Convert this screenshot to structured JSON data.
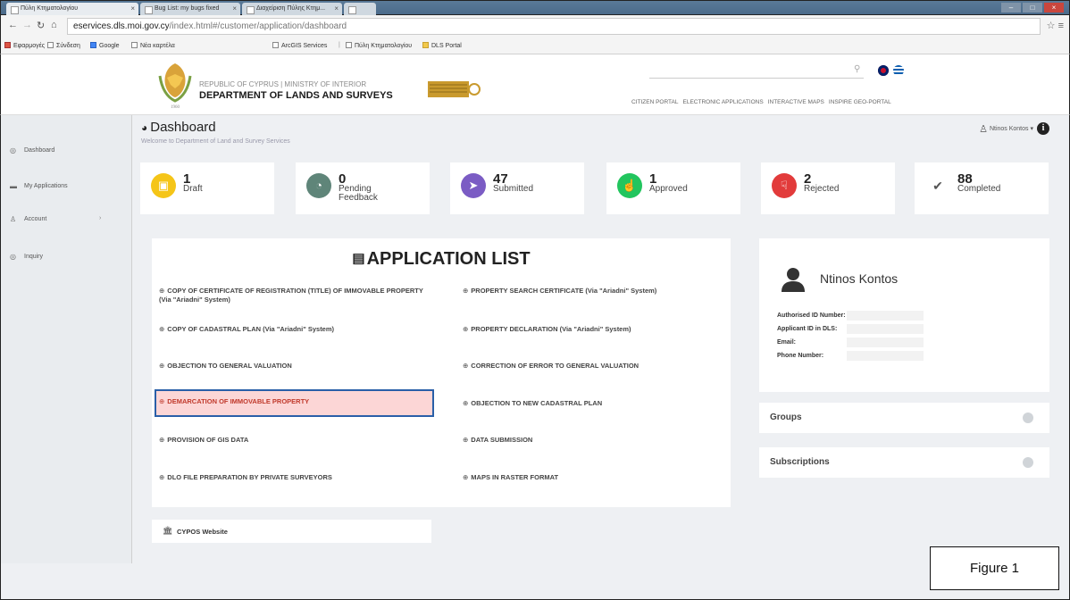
{
  "browser": {
    "tabs": [
      {
        "label": "Πύλη Κτηματολογίου",
        "active": true
      },
      {
        "label": "Bug List: my bugs fixed"
      },
      {
        "label": "Διαχείριση Πύλης Κτημ..."
      }
    ],
    "url_host": "eservices.dls.moi.gov.cy",
    "url_path": "/index.html#/customer/application/dashboard",
    "bookmarks": [
      "Εφαρμογές",
      "Σύνδεση",
      "Google",
      "Νέα καρτέλα",
      "ArcGIS Services",
      "Πύλη Κτηματολογίου",
      "DLS Portal"
    ]
  },
  "header": {
    "dept_line1": "REPUBLIC OF CYPRUS | MINISTRY OF INTERIOR",
    "dept_line2": "DEPARTMENT OF LANDS AND SURVEYS",
    "nav": [
      "CITIZEN PORTAL",
      "ELECTRONIC APPLICATIONS",
      "INTERACTIVE MAPS",
      "INSPIRE GEO-PORTAL"
    ]
  },
  "sidebar": {
    "items": [
      {
        "label": "Dashboard",
        "icon": "dashboard-icon"
      },
      {
        "label": "My Applications",
        "icon": "applications-icon"
      },
      {
        "label": "Account",
        "icon": "user-icon"
      },
      {
        "label": "Inquiry",
        "icon": "inquiry-icon"
      }
    ]
  },
  "dashboard": {
    "title": "Dashboard",
    "subtitle": "Welcome to Department of Land and Survey Services",
    "user": "Ntinos Kontos"
  },
  "stats": [
    {
      "count": "1",
      "label": "Draft",
      "color": "#f5c518",
      "icon": "draft-icon"
    },
    {
      "count": "0",
      "label": "Pending Feedback",
      "color": "#5f8579",
      "icon": "chat-icon"
    },
    {
      "count": "47",
      "label": "Submitted",
      "color": "#7b5cc4",
      "icon": "send-icon"
    },
    {
      "count": "1",
      "label": "Approved",
      "color": "#22c55e",
      "icon": "thumbs-up-icon"
    },
    {
      "count": "2",
      "label": "Rejected",
      "color": "#e23b3b",
      "icon": "thumbs-down-icon"
    },
    {
      "count": "88",
      "label": "Completed",
      "color": "#555555",
      "icon": "check-circle-icon"
    }
  ],
  "application_list": {
    "title": "APPLICATION LIST",
    "left": [
      "COPY OF CERTIFICATE OF REGISTRATION (TITLE) OF IMMOVABLE PROPERTY (Via \"Ariadni\" System)",
      "COPY OF CADASTRAL PLAN (Via \"Ariadni\" System)",
      "OBJECTION TO GENERAL VALUATION",
      "DEMARCATION OF IMMOVABLE PROPERTY",
      "PROVISION OF GIS DATA",
      "DLO FILE PREPARATION BY PRIVATE SURVEYORS"
    ],
    "right": [
      "PROPERTY SEARCH CERTIFICATE (Via \"Ariadni\" System)",
      "PROPERTY DECLARATION (Via \"Ariadni\" System)",
      "CORRECTION OF ERROR TO GENERAL VALUATION",
      "OBJECTION TO NEW CADASTRAL PLAN",
      "DATA SUBMISSION",
      "MAPS IN RASTER FORMAT"
    ],
    "highlight_color": "#fcd6d6"
  },
  "website_link": "CYPOS Website",
  "profile": {
    "name": "Ntinos Kontos",
    "fields": [
      "Authorised ID Number:",
      "Applicant ID in DLS:",
      "Email:",
      "Phone Number:"
    ]
  },
  "side_panels": [
    "Groups",
    "Subscriptions"
  ],
  "figure_label": "Figure 1"
}
